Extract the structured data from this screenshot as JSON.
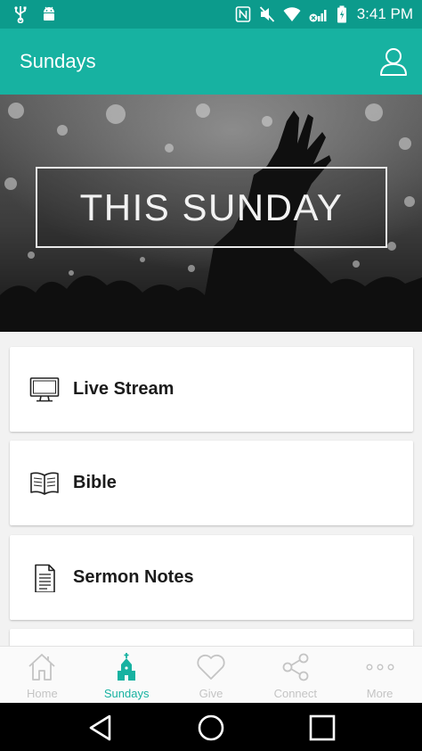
{
  "status_bar": {
    "time": "3:41 PM",
    "icons": [
      "usb-icon",
      "android-icon",
      "nfc-icon",
      "mute-icon",
      "wifi-icon",
      "signal-icon",
      "battery-icon"
    ]
  },
  "app_bar": {
    "title": "Sundays",
    "profile_icon": "user-icon"
  },
  "hero": {
    "title": "THIS SUNDAY"
  },
  "cards": [
    {
      "label": "Live Stream",
      "icon": "monitor-icon"
    },
    {
      "label": "Bible",
      "icon": "book-icon"
    },
    {
      "label": "Sermon Notes",
      "icon": "document-icon"
    }
  ],
  "bottom_nav": {
    "items": [
      {
        "label": "Home",
        "icon": "home-icon",
        "active": false
      },
      {
        "label": "Sundays",
        "icon": "church-icon",
        "active": true
      },
      {
        "label": "Give",
        "icon": "heart-icon",
        "active": false
      },
      {
        "label": "Connect",
        "icon": "share-icon",
        "active": false
      },
      {
        "label": "More",
        "icon": "more-icon",
        "active": false
      }
    ]
  },
  "system_nav": [
    "back-icon",
    "home-circle-icon",
    "recents-icon"
  ],
  "colors": {
    "status_bar": "#0c9b8c",
    "app_bar": "#17b2a1",
    "accent": "#17b2a1",
    "inactive": "#c4c4c4"
  }
}
